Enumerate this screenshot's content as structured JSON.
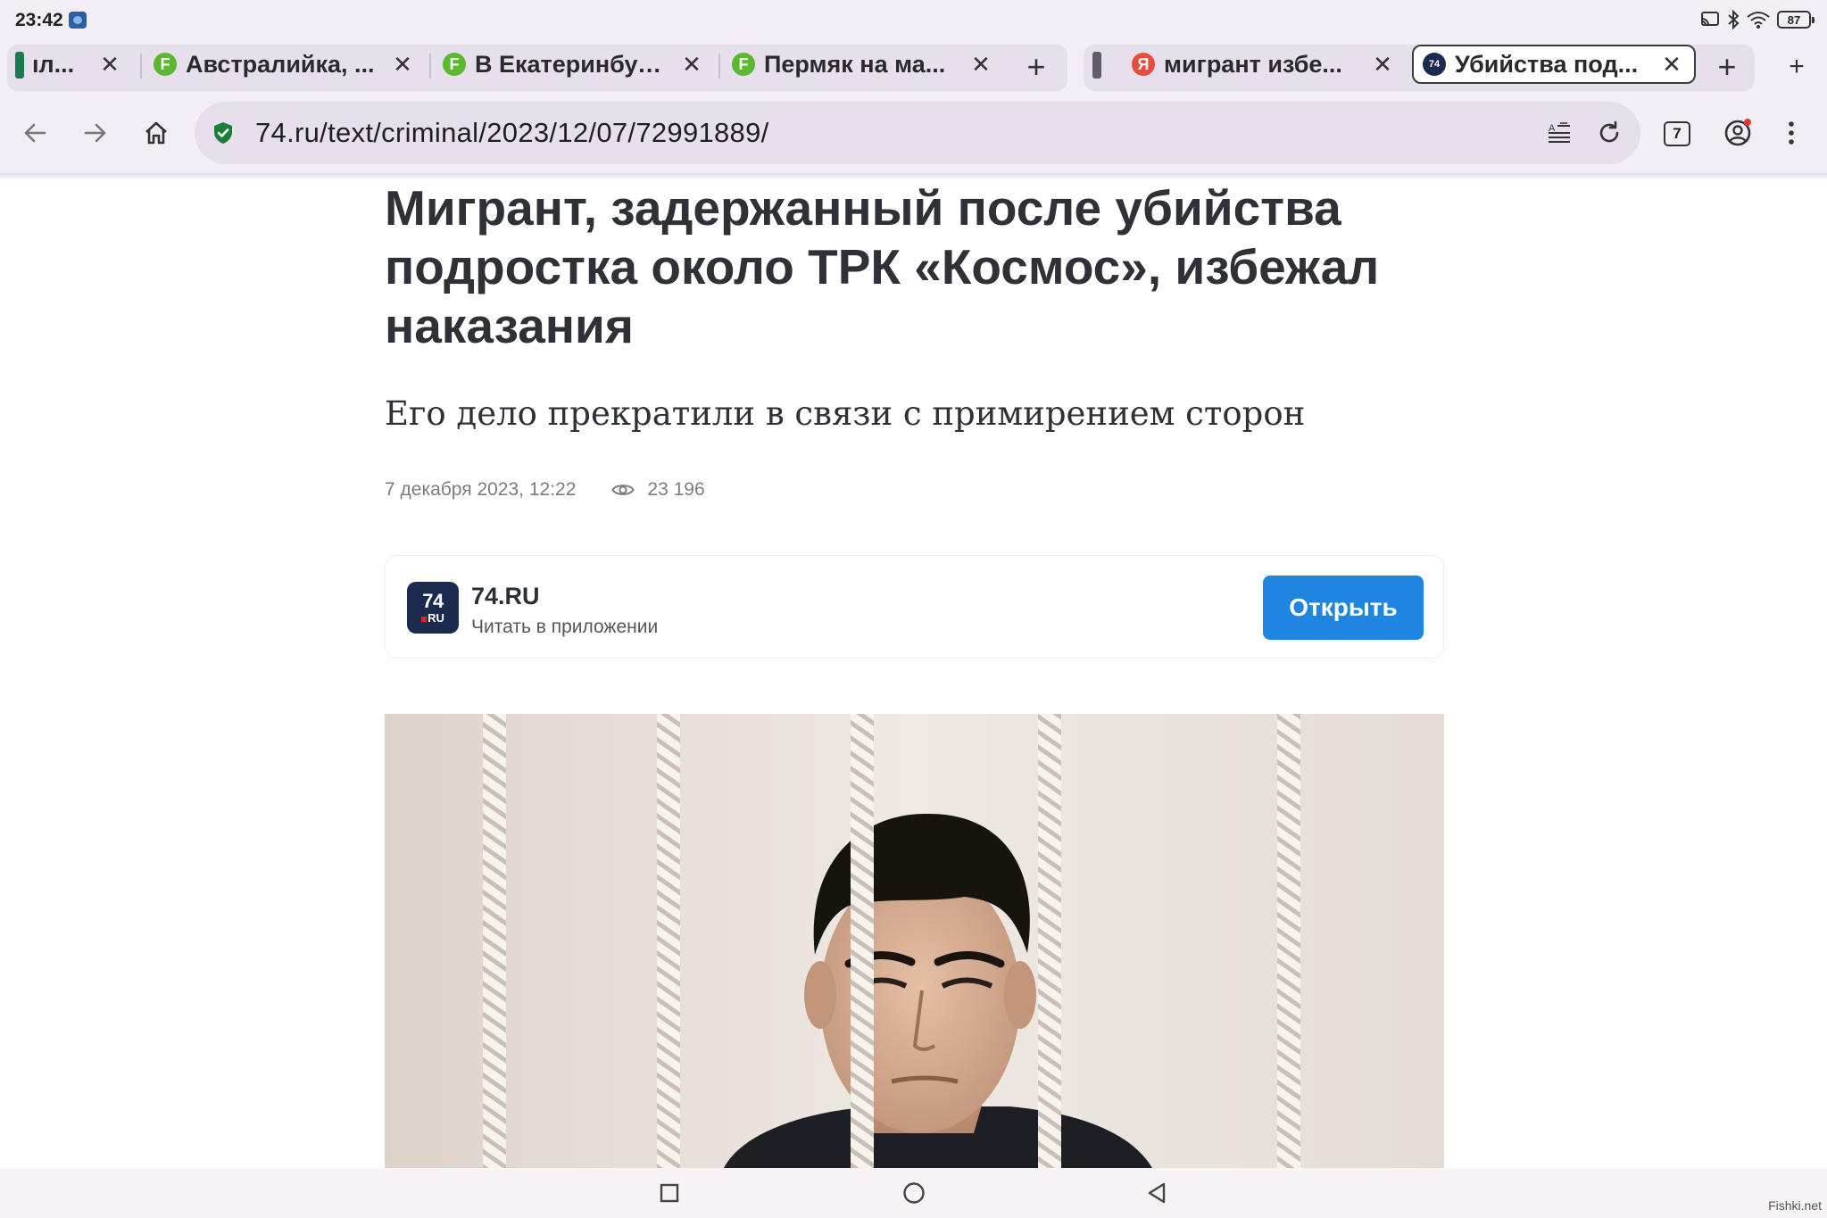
{
  "status_bar": {
    "time": "23:42",
    "battery": "87"
  },
  "tabs": [
    {
      "title": "ıл...",
      "favicon": "green-bar",
      "close": "✕",
      "active": false
    },
    {
      "title": "Австралийка, ...",
      "favicon": "F",
      "favicon_color": "#5bb82f",
      "close": "✕",
      "active": false
    },
    {
      "title": "В Екатеринбур...",
      "favicon": "F",
      "favicon_color": "#5bb82f",
      "close": "✕",
      "active": false
    },
    {
      "title": "Пермяк на ма...",
      "favicon": "F",
      "favicon_color": "#5bb82f",
      "close": "✕",
      "active": false
    },
    {
      "title": "мигрант избе...",
      "favicon": "Я",
      "favicon_color": "#e84e3c",
      "close": "✕",
      "active": false
    },
    {
      "title": "Убийства под...",
      "favicon": "74",
      "favicon_color": "#1c2a4f",
      "close": "✕",
      "active": true
    }
  ],
  "tab_strip": {
    "new_tab": "+",
    "overflow_add": "+"
  },
  "toolbar": {
    "url": "74.ru/text/criminal/2023/12/07/72991889/",
    "tab_count": "7"
  },
  "article": {
    "headline": "Мигрант, задержанный после убийства подростка около ТРК «Космос», избежал наказания",
    "subtitle": "Его дело прекратили в связи с примирением сторон",
    "date": "7 декабря 2023, 12:22",
    "views": "23 196"
  },
  "app_banner": {
    "logo_line1": "74",
    "logo_line2": "RU",
    "name": "74.RU",
    "subtitle": "Читать в приложении",
    "button": "Открыть"
  },
  "watermark": "Fishki.net",
  "colors": {
    "browser_chrome": "#f3eef6",
    "omnibox": "#e7e0ec",
    "accent_button": "#1e86e0",
    "headline": "#2e3138",
    "secure_shield": "#1a7f37"
  }
}
